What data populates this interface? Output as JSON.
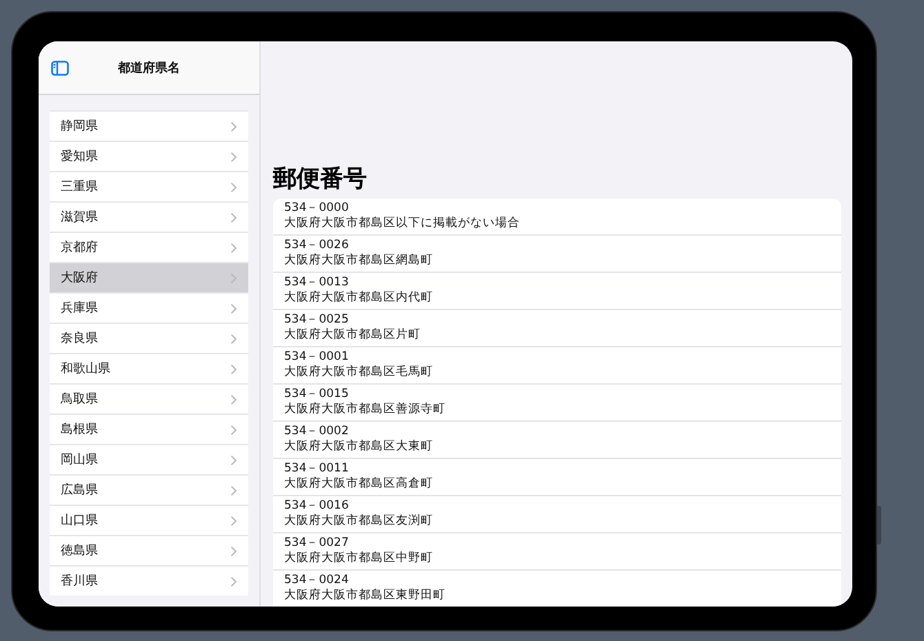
{
  "sidebar": {
    "title": "都道府県名",
    "items": [
      {
        "label": "静岡県",
        "selected": false
      },
      {
        "label": "愛知県",
        "selected": false
      },
      {
        "label": "三重県",
        "selected": false
      },
      {
        "label": "滋賀県",
        "selected": false
      },
      {
        "label": "京都府",
        "selected": false
      },
      {
        "label": "大阪府",
        "selected": true
      },
      {
        "label": "兵庫県",
        "selected": false
      },
      {
        "label": "奈良県",
        "selected": false
      },
      {
        "label": "和歌山県",
        "selected": false
      },
      {
        "label": "鳥取県",
        "selected": false
      },
      {
        "label": "島根県",
        "selected": false
      },
      {
        "label": "岡山県",
        "selected": false
      },
      {
        "label": "広島県",
        "selected": false
      },
      {
        "label": "山口県",
        "selected": false
      },
      {
        "label": "徳島県",
        "selected": false
      },
      {
        "label": "香川県",
        "selected": false
      }
    ]
  },
  "detail": {
    "title": "郵便番号",
    "rows": [
      {
        "code": "534－0000",
        "address": "大阪府大阪市都島区以下に掲載がない場合"
      },
      {
        "code": "534－0026",
        "address": "大阪府大阪市都島区網島町"
      },
      {
        "code": "534－0013",
        "address": "大阪府大阪市都島区内代町"
      },
      {
        "code": "534－0025",
        "address": "大阪府大阪市都島区片町"
      },
      {
        "code": "534－0001",
        "address": "大阪府大阪市都島区毛馬町"
      },
      {
        "code": "534－0015",
        "address": "大阪府大阪市都島区善源寺町"
      },
      {
        "code": "534－0002",
        "address": "大阪府大阪市都島区大東町"
      },
      {
        "code": "534－0011",
        "address": "大阪府大阪市都島区高倉町"
      },
      {
        "code": "534－0016",
        "address": "大阪府大阪市都島区友渕町"
      },
      {
        "code": "534－0027",
        "address": "大阪府大阪市都島区中野町"
      },
      {
        "code": "534－0024",
        "address": "大阪府大阪市都島区東野田町"
      }
    ]
  }
}
